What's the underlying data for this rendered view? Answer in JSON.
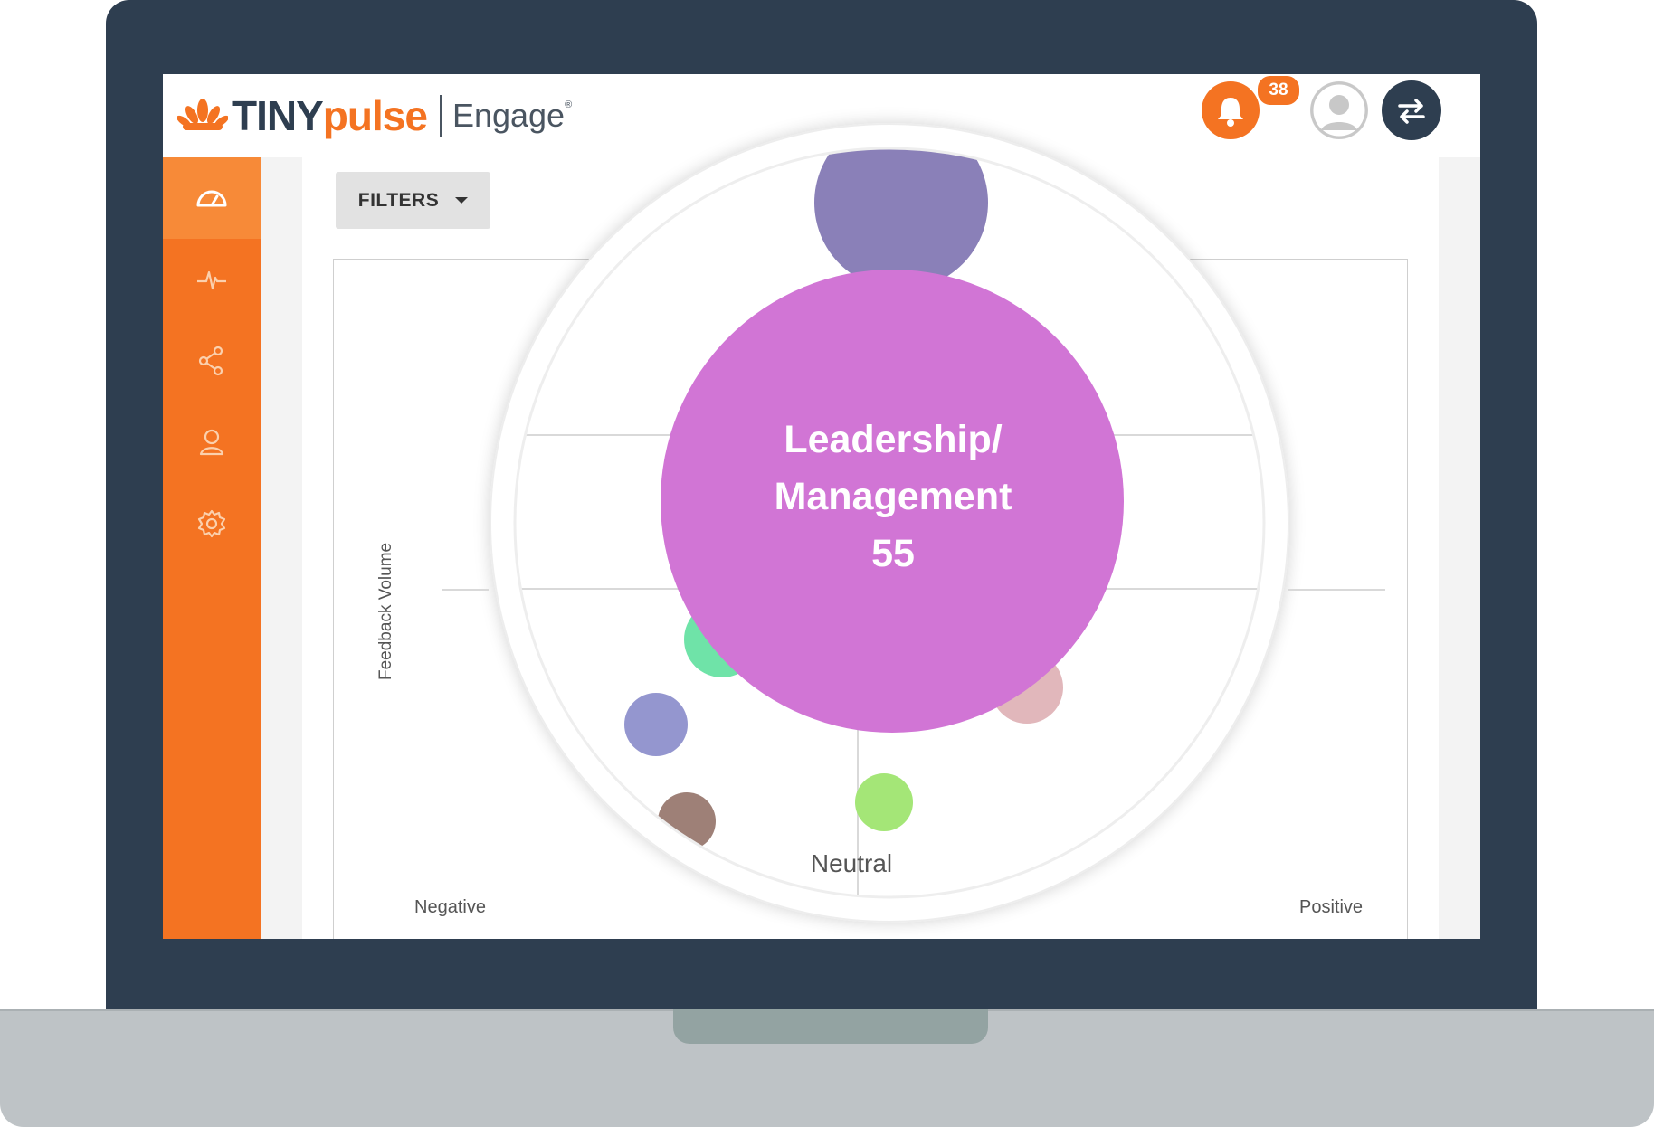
{
  "header": {
    "logo_tiny": "TINY",
    "logo_pulse": "pulse",
    "logo_engage": "Engage",
    "logo_reg": "®",
    "notification_count": "38"
  },
  "sidebar": {
    "items": [
      {
        "icon": "dashboard-gauge-icon",
        "active": true
      },
      {
        "icon": "pulse-line-icon",
        "active": false
      },
      {
        "icon": "share-icon",
        "active": false
      },
      {
        "icon": "user-icon",
        "active": false
      },
      {
        "icon": "gear-icon",
        "active": false
      }
    ]
  },
  "toolbar": {
    "filters_label": "FILTERS"
  },
  "chart": {
    "ylabel": "Feedback Volume",
    "x_left": "Negative",
    "x_center": "Neutral",
    "x_right": "Positive"
  },
  "chart_data": {
    "type": "scatter",
    "ylabel": "Feedback Volume",
    "x_tick_labels": [
      "Negative",
      "Neutral",
      "Positive"
    ],
    "highlight": {
      "label_line1": "Leadership/",
      "label_line2": "Management",
      "value": "55"
    },
    "bubble_colors": [
      "#8a80b8",
      "#d175d5",
      "#6fe3a8",
      "#9496cf",
      "#9e8077",
      "#a4e677",
      "#e1b7bb"
    ]
  },
  "colors": {
    "brand_orange": "#f47322",
    "bezel_navy": "#2e3e50"
  }
}
